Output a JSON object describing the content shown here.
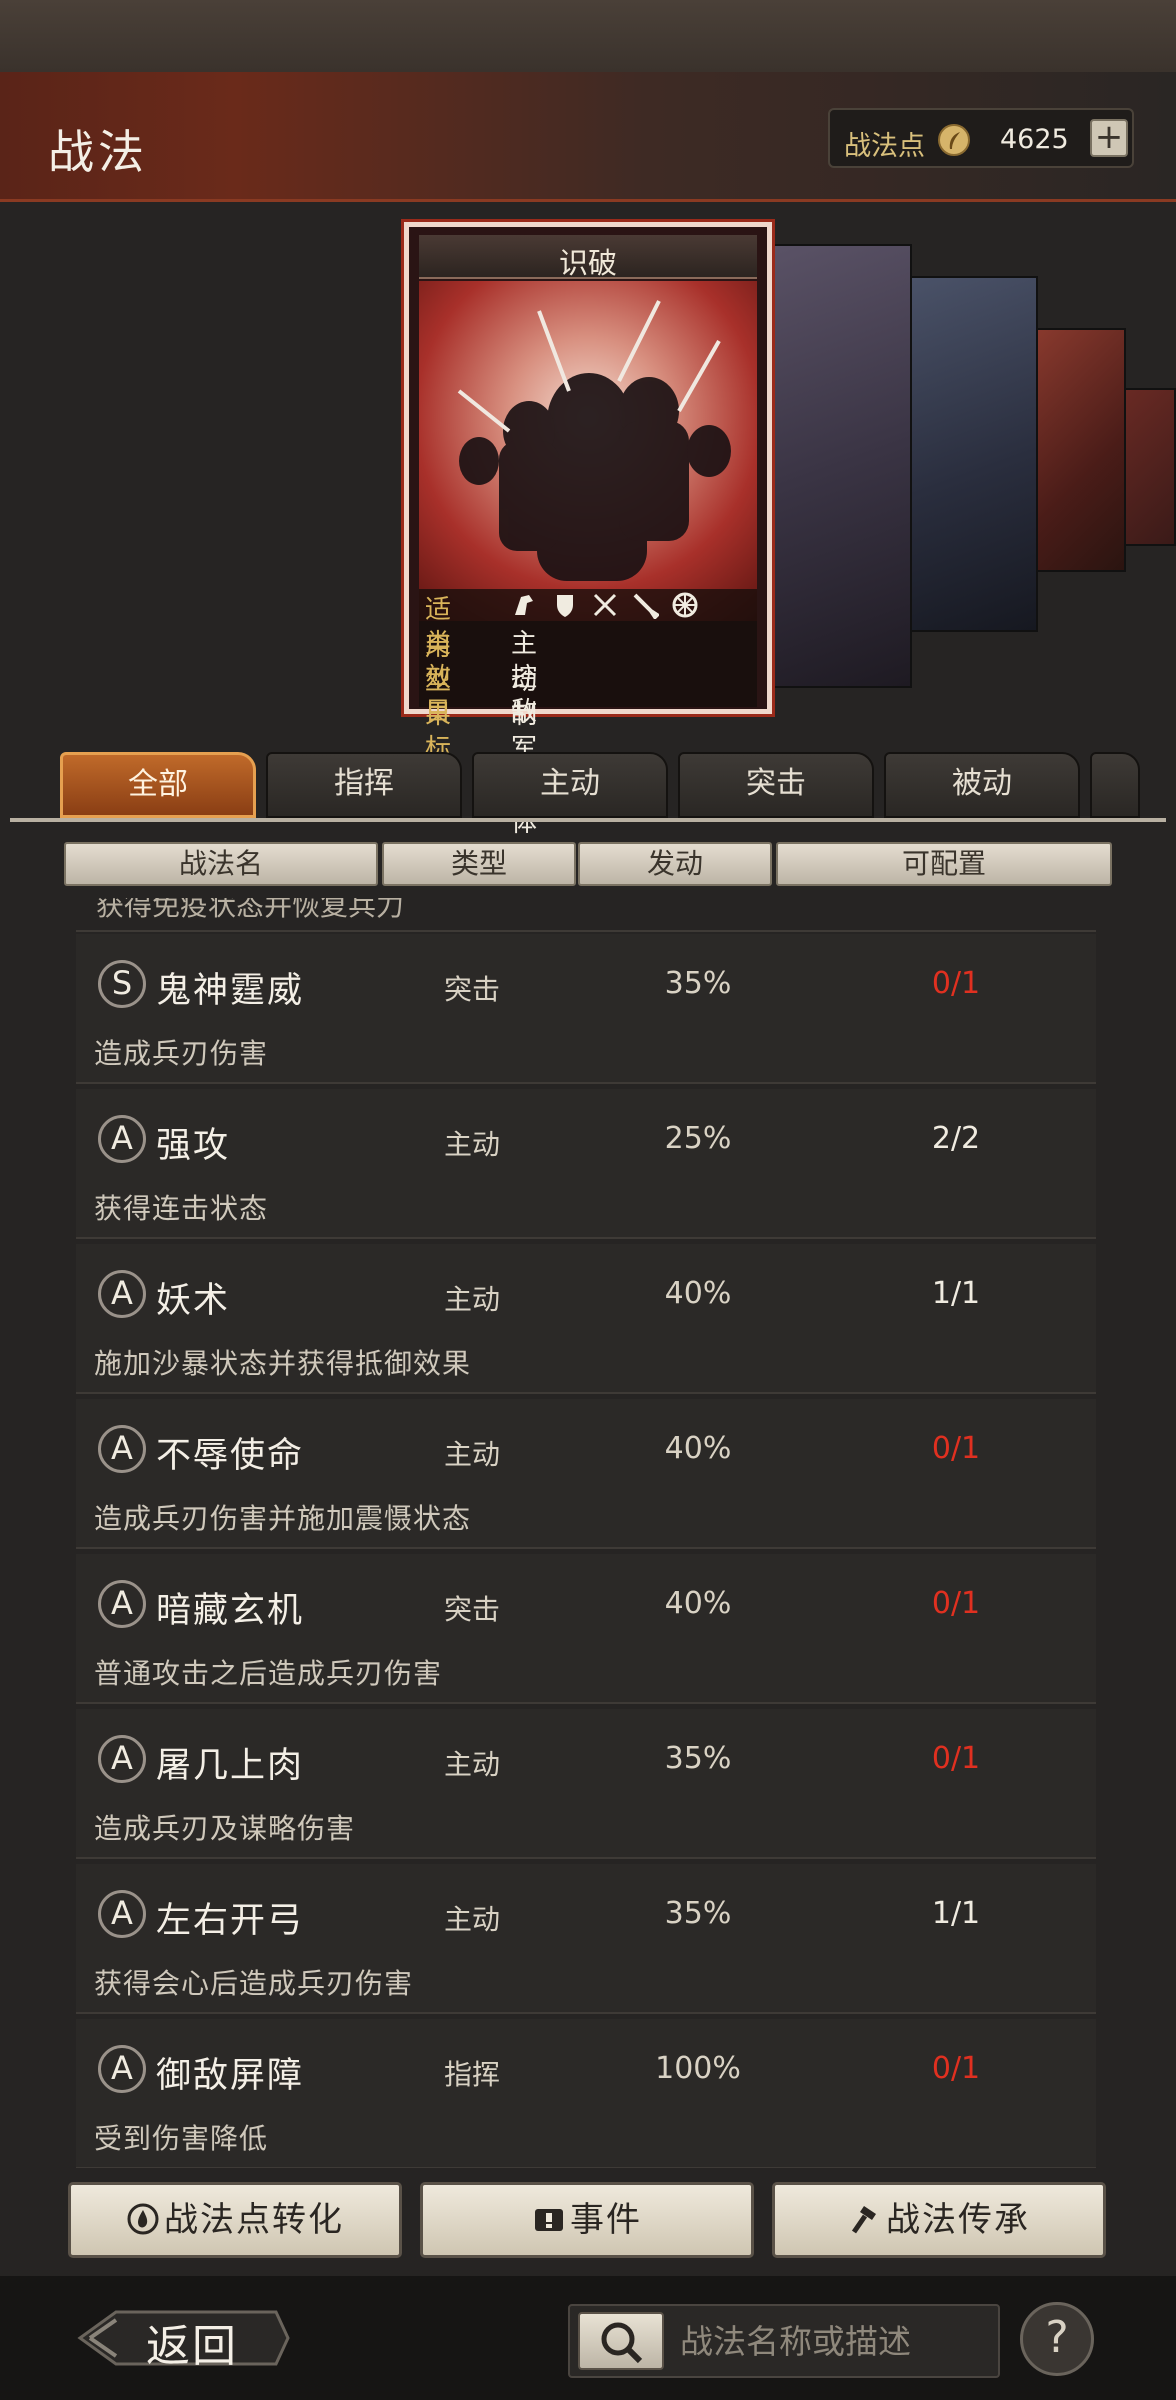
{
  "header": {
    "title": "战法",
    "points_label": "战法点",
    "points_value": "4625",
    "points_icon": "feather-icon",
    "add_icon": "plus-icon"
  },
  "featured_card": {
    "title": "识破",
    "applicable_label": "适用",
    "applicable_icons": [
      "cavalry-icon",
      "shield-icon",
      "archer-icon",
      "spear-icon",
      "wheel-icon"
    ],
    "type_label": "类型",
    "type_value": "主动",
    "effect_label": "效果",
    "effect_value": "控制",
    "target_label": "目标",
    "target_value": "敌军单体"
  },
  "tabs": [
    {
      "label": "全部",
      "active": true
    },
    {
      "label": "指挥",
      "active": false
    },
    {
      "label": "主动",
      "active": false
    },
    {
      "label": "突击",
      "active": false
    },
    {
      "label": "被动",
      "active": false
    }
  ],
  "table": {
    "columns": [
      "战法名",
      "类型",
      "发动",
      "可配置"
    ]
  },
  "partial_row_desc": "获得免疫状态并恢复兵力",
  "skills": [
    {
      "grade": "S",
      "name": "鬼神霆威",
      "type": "突击",
      "rate": "35%",
      "slots": "0/1",
      "slots_color": "#e03020",
      "desc": "造成兵刃伤害"
    },
    {
      "grade": "A",
      "name": "强攻",
      "type": "主动",
      "rate": "25%",
      "slots": "2/2",
      "slots_color": "#f0ebe0",
      "desc": "获得连击状态"
    },
    {
      "grade": "A",
      "name": "妖术",
      "type": "主动",
      "rate": "40%",
      "slots": "1/1",
      "slots_color": "#f0ebe0",
      "desc": "施加沙暴状态并获得抵御效果"
    },
    {
      "grade": "A",
      "name": "不辱使命",
      "type": "主动",
      "rate": "40%",
      "slots": "0/1",
      "slots_color": "#e03020",
      "desc": "造成兵刃伤害并施加震慑状态"
    },
    {
      "grade": "A",
      "name": "暗藏玄机",
      "type": "突击",
      "rate": "40%",
      "slots": "0/1",
      "slots_color": "#e03020",
      "desc": "普通攻击之后造成兵刃伤害"
    },
    {
      "grade": "A",
      "name": "屠几上肉",
      "type": "主动",
      "rate": "35%",
      "slots": "0/1",
      "slots_color": "#e03020",
      "desc": "造成兵刃及谋略伤害"
    },
    {
      "grade": "A",
      "name": "左右开弓",
      "type": "主动",
      "rate": "35%",
      "slots": "1/1",
      "slots_color": "#f0ebe0",
      "desc": "获得会心后造成兵刃伤害"
    },
    {
      "grade": "A",
      "name": "御敌屏障",
      "type": "指挥",
      "rate": "100%",
      "slots": "0/1",
      "slots_color": "#e03020",
      "desc": "受到伤害降低"
    }
  ],
  "actions": {
    "convert_label": "战法点转化",
    "convert_icon": "drop-icon",
    "events_label": "事件",
    "events_icon": "scroll-icon",
    "inherit_label": "战法传承",
    "inherit_icon": "hammer-icon"
  },
  "bottom": {
    "back_label": "返回",
    "search_placeholder": "战法名称或描述",
    "search_icon": "magnifier-icon",
    "help_label": "?"
  }
}
